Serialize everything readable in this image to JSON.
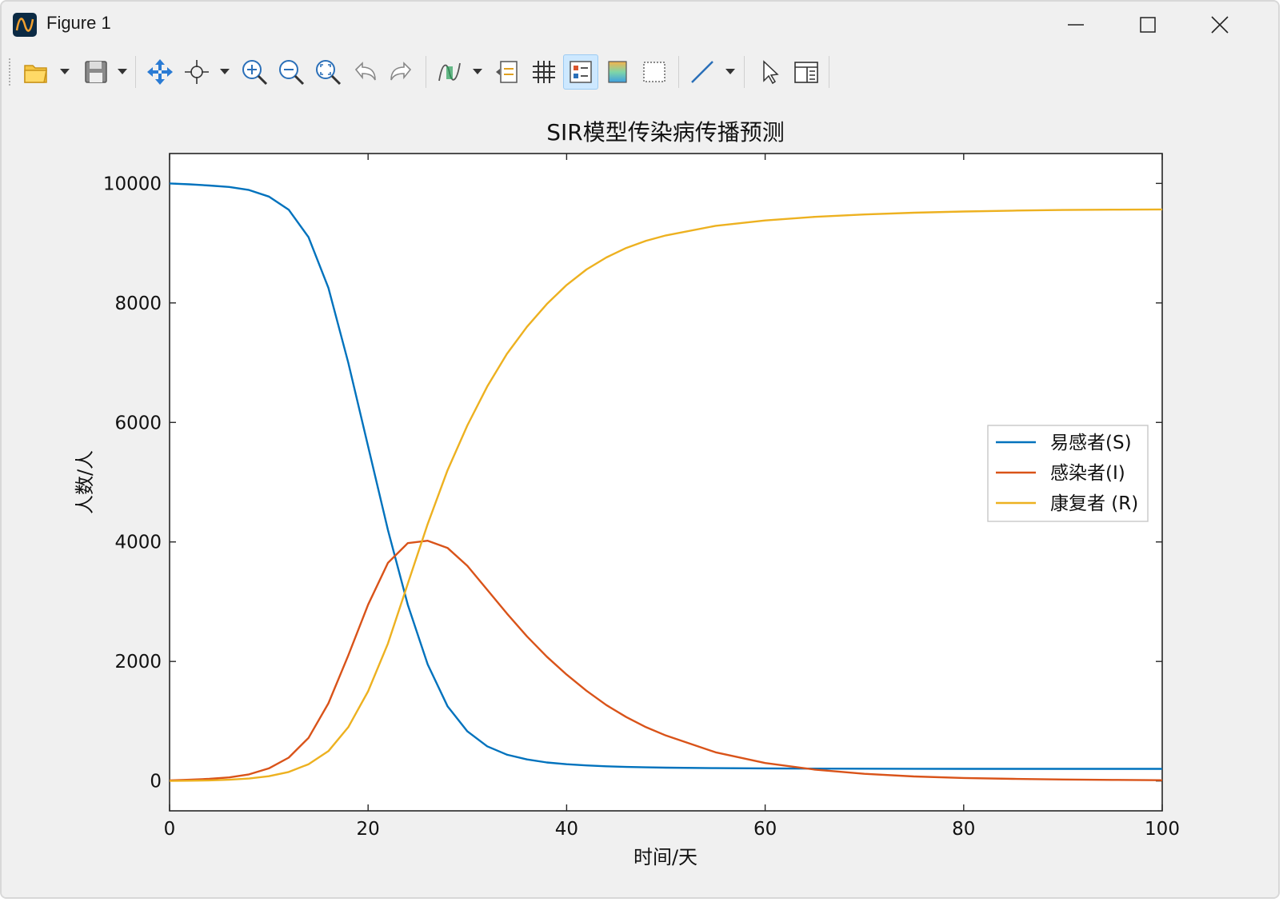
{
  "window": {
    "title": "Figure 1"
  },
  "toolbar": {
    "buttons": [
      {
        "icon": "open-folder-icon"
      },
      {
        "icon": "save-icon"
      },
      {
        "icon": "pan-icon"
      },
      {
        "icon": "data-cursor-icon"
      },
      {
        "icon": "zoom-in-icon"
      },
      {
        "icon": "zoom-out-icon"
      },
      {
        "icon": "restore-view-icon"
      },
      {
        "icon": "undo-icon"
      },
      {
        "icon": "redo-icon"
      },
      {
        "icon": "brush-icon"
      },
      {
        "icon": "insert-legend-icon"
      },
      {
        "icon": "grid-icon"
      },
      {
        "icon": "legend-icon"
      },
      {
        "icon": "colorbar-icon"
      },
      {
        "icon": "plot-edit-icon"
      },
      {
        "icon": "insert-line-icon"
      },
      {
        "icon": "select-arrow-icon"
      },
      {
        "icon": "property-inspector-icon"
      }
    ],
    "active": "legend-icon"
  },
  "chart_data": {
    "type": "line",
    "title": "SIR模型传染病传播预测",
    "xlabel": "时间/天",
    "ylabel": "人数/人",
    "xlim": [
      0,
      100
    ],
    "ylim": [
      -500,
      10500
    ],
    "xticks": [
      0,
      20,
      40,
      60,
      80,
      100
    ],
    "yticks": [
      0,
      2000,
      4000,
      6000,
      8000,
      10000
    ],
    "legend_position": "right",
    "grid": false,
    "x": [
      0,
      2,
      4,
      6,
      8,
      10,
      12,
      14,
      16,
      18,
      20,
      22,
      24,
      26,
      28,
      30,
      32,
      34,
      36,
      38,
      40,
      42,
      44,
      46,
      48,
      50,
      55,
      60,
      65,
      70,
      75,
      80,
      85,
      90,
      95,
      100
    ],
    "series": [
      {
        "name": "易感者(S)",
        "color": "#0072BD",
        "values": [
          10000,
          9985,
          9965,
          9940,
          9890,
          9780,
          9560,
          9100,
          8250,
          7000,
          5600,
          4200,
          2950,
          1950,
          1250,
          830,
          580,
          440,
          360,
          310,
          280,
          260,
          245,
          235,
          228,
          222,
          214,
          210,
          207,
          205,
          204,
          203,
          202,
          202,
          202,
          202
        ]
      },
      {
        "name": "感染者(I)",
        "color": "#D95319",
        "values": [
          10,
          20,
          35,
          60,
          110,
          210,
          390,
          720,
          1300,
          2100,
          2950,
          3650,
          3980,
          4020,
          3900,
          3600,
          3200,
          2800,
          2420,
          2080,
          1780,
          1510,
          1270,
          1070,
          900,
          760,
          480,
          300,
          190,
          120,
          75,
          50,
          35,
          25,
          18,
          12
        ]
      },
      {
        "name": "康复者 (R)",
        "color": "#EDB120",
        "values": [
          0,
          5,
          10,
          20,
          40,
          80,
          150,
          280,
          500,
          900,
          1500,
          2300,
          3300,
          4300,
          5200,
          5950,
          6600,
          7150,
          7600,
          7980,
          8300,
          8560,
          8760,
          8920,
          9040,
          9130,
          9290,
          9380,
          9440,
          9480,
          9510,
          9530,
          9545,
          9555,
          9560,
          9565
        ]
      }
    ]
  }
}
